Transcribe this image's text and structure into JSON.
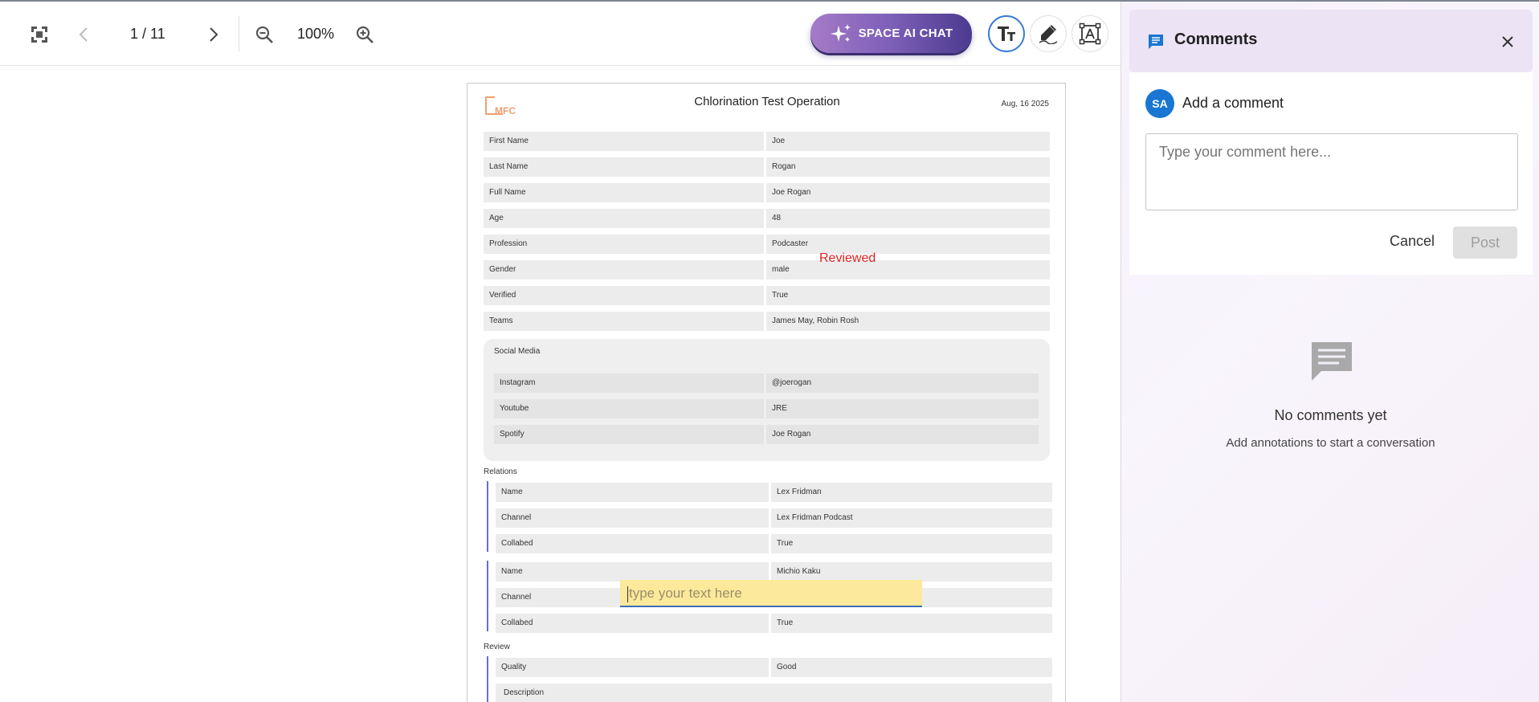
{
  "toolbar": {
    "page_indicator": "1 / 11",
    "zoom_level": "100%",
    "ai_button_label": "SPACE AI CHAT"
  },
  "document": {
    "title": "Chlorination Test Operation",
    "date": "Aug, 16 2025",
    "logo_text": "MFC",
    "fields": [
      {
        "label": "First Name",
        "value": "Joe"
      },
      {
        "label": "Last Name",
        "value": "Rogan"
      },
      {
        "label": "Full Name",
        "value": "Joe Rogan"
      },
      {
        "label": "Age",
        "value": "48"
      },
      {
        "label": "Profession",
        "value": "Podcaster"
      },
      {
        "label": "Gender",
        "value": "male"
      },
      {
        "label": "Verified",
        "value": "True"
      },
      {
        "label": "Teams",
        "value": "James May, Robin Rosh"
      }
    ],
    "social_media": {
      "title": "Social Media",
      "items": [
        {
          "label": "Instagram",
          "value": "@joerogan"
        },
        {
          "label": "Youtube",
          "value": "JRE"
        },
        {
          "label": "Spotify",
          "value": "Joe Rogan"
        }
      ]
    },
    "relations": {
      "title": "Relations",
      "entries": [
        [
          {
            "label": "Name",
            "value": "Lex Fridman"
          },
          {
            "label": "Channel",
            "value": "Lex Fridman Podcast"
          },
          {
            "label": "Collabed",
            "value": "True"
          }
        ],
        [
          {
            "label": "Name",
            "value": "Michio Kaku"
          },
          {
            "label": "Channel",
            "value": ""
          },
          {
            "label": "Collabed",
            "value": "True"
          }
        ]
      ]
    },
    "review": {
      "title": "Review",
      "items": [
        {
          "label": "Quality",
          "value": "Good"
        },
        {
          "label": "Description",
          "value": ""
        }
      ]
    },
    "stamp_text": "Reviewed",
    "text_annotation_placeholder": "type your text here"
  },
  "comments": {
    "title": "Comments",
    "avatar_initials": "SA",
    "add_comment_label": "Add a comment",
    "input_placeholder": "Type your comment here...",
    "cancel_label": "Cancel",
    "post_label": "Post",
    "empty_title": "No comments yet",
    "empty_subtitle": "Add annotations to start a conversation"
  },
  "colors": {
    "accent_blue": "#1976d2",
    "stamp_red": "#e02020",
    "annotation_yellow": "#fde99b",
    "relation_bar": "#6a6ae0"
  }
}
